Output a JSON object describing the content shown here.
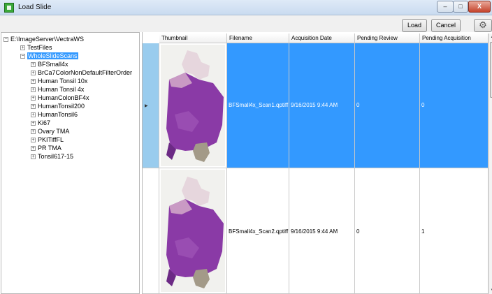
{
  "window": {
    "title": "Load Slide",
    "min_glyph": "–",
    "max_glyph": "□",
    "close_glyph": "X"
  },
  "toolbar": {
    "load_label": "Load",
    "cancel_label": "Cancel",
    "settings_icon": "gear-icon",
    "gear_glyph": "⚙"
  },
  "tree": {
    "root": "E:\\ImageServer\\VectraWS",
    "nodes": [
      {
        "label": "TestFiles",
        "level": 1,
        "expanded": false
      },
      {
        "label": "WholeSlideScans",
        "level": 1,
        "expanded": true,
        "selected": true
      },
      {
        "label": "BFSmall4x",
        "level": 2
      },
      {
        "label": "BrCa7ColorNonDefaultFilterOrder",
        "level": 2
      },
      {
        "label": "Human Tonsil 10x",
        "level": 2
      },
      {
        "label": "Human Tonsil 4x",
        "level": 2
      },
      {
        "label": "HumanColonBF4x",
        "level": 2
      },
      {
        "label": "HumanTonsil200",
        "level": 2
      },
      {
        "label": "HumanTonsil6",
        "level": 2
      },
      {
        "label": "Ki67",
        "level": 2
      },
      {
        "label": "Ovary TMA",
        "level": 2
      },
      {
        "label": "PKITiffFL",
        "level": 2
      },
      {
        "label": "PR TMA",
        "level": 2
      },
      {
        "label": "Tonsil617-15",
        "level": 2
      }
    ]
  },
  "grid": {
    "columns": [
      "Thumbnail",
      "Filename",
      "Acquisition Date",
      "Pending Review",
      "Pending Acquisition"
    ],
    "rows": [
      {
        "filename": "BFSmall4x_Scan1.qptiff",
        "acquisition_date": "9/16/2015 9:44 AM",
        "pending_review": "0",
        "pending_acquisition": "0",
        "selected": true
      },
      {
        "filename": "BFSmall4x_Scan2.qptiff",
        "acquisition_date": "9/16/2015 9:44 AM",
        "pending_review": "0",
        "pending_acquisition": "1",
        "selected": false
      }
    ]
  },
  "colors": {
    "selection": "#3399ff",
    "tissue": "#8a3aa6",
    "tissue_light": "#c99ac4",
    "tissue_bottom": "#a39a88"
  }
}
